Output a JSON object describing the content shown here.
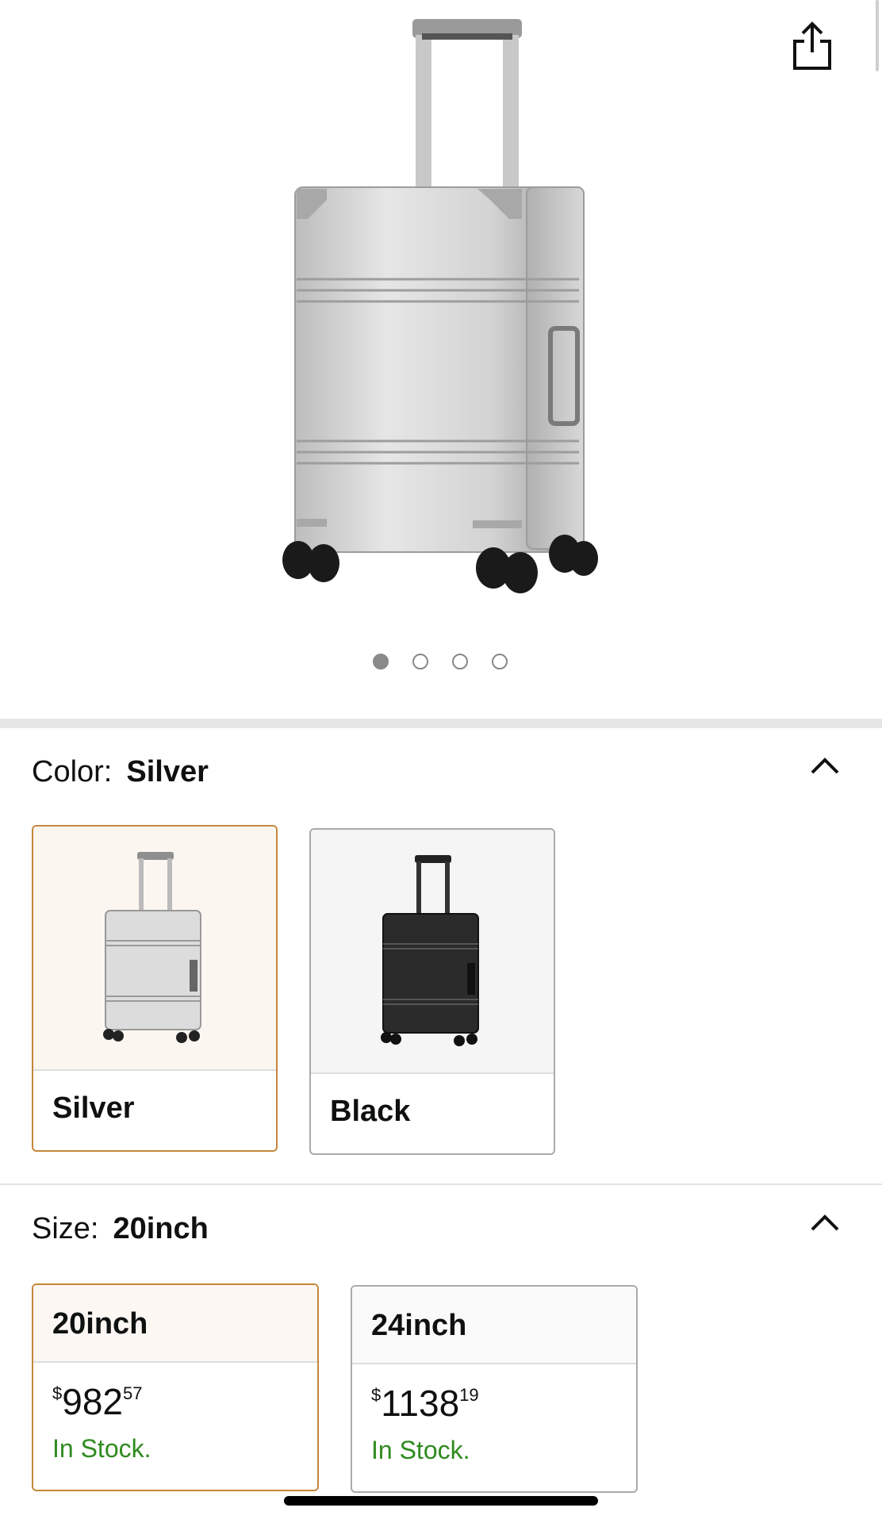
{
  "image_carousel": {
    "page_count": 4,
    "active_index": 0
  },
  "color": {
    "label": "Color:",
    "selected_value": "Silver",
    "options": [
      {
        "name": "Silver",
        "selected": true
      },
      {
        "name": "Black",
        "selected": false
      }
    ]
  },
  "size": {
    "label": "Size:",
    "selected_value": "20inch",
    "options": [
      {
        "name": "20inch",
        "price_symbol": "$",
        "price_whole": "982",
        "price_fraction": "57",
        "stock": "In Stock.",
        "selected": true
      },
      {
        "name": "24inch",
        "price_symbol": "$",
        "price_whole": "1138",
        "price_fraction": "19",
        "stock": "In Stock.",
        "selected": false
      }
    ]
  },
  "icons": {
    "share": "share-icon",
    "collapse": "chevron-up-icon"
  },
  "colors": {
    "selected_border": "#c4873d",
    "in_stock": "#2e8b1e"
  }
}
